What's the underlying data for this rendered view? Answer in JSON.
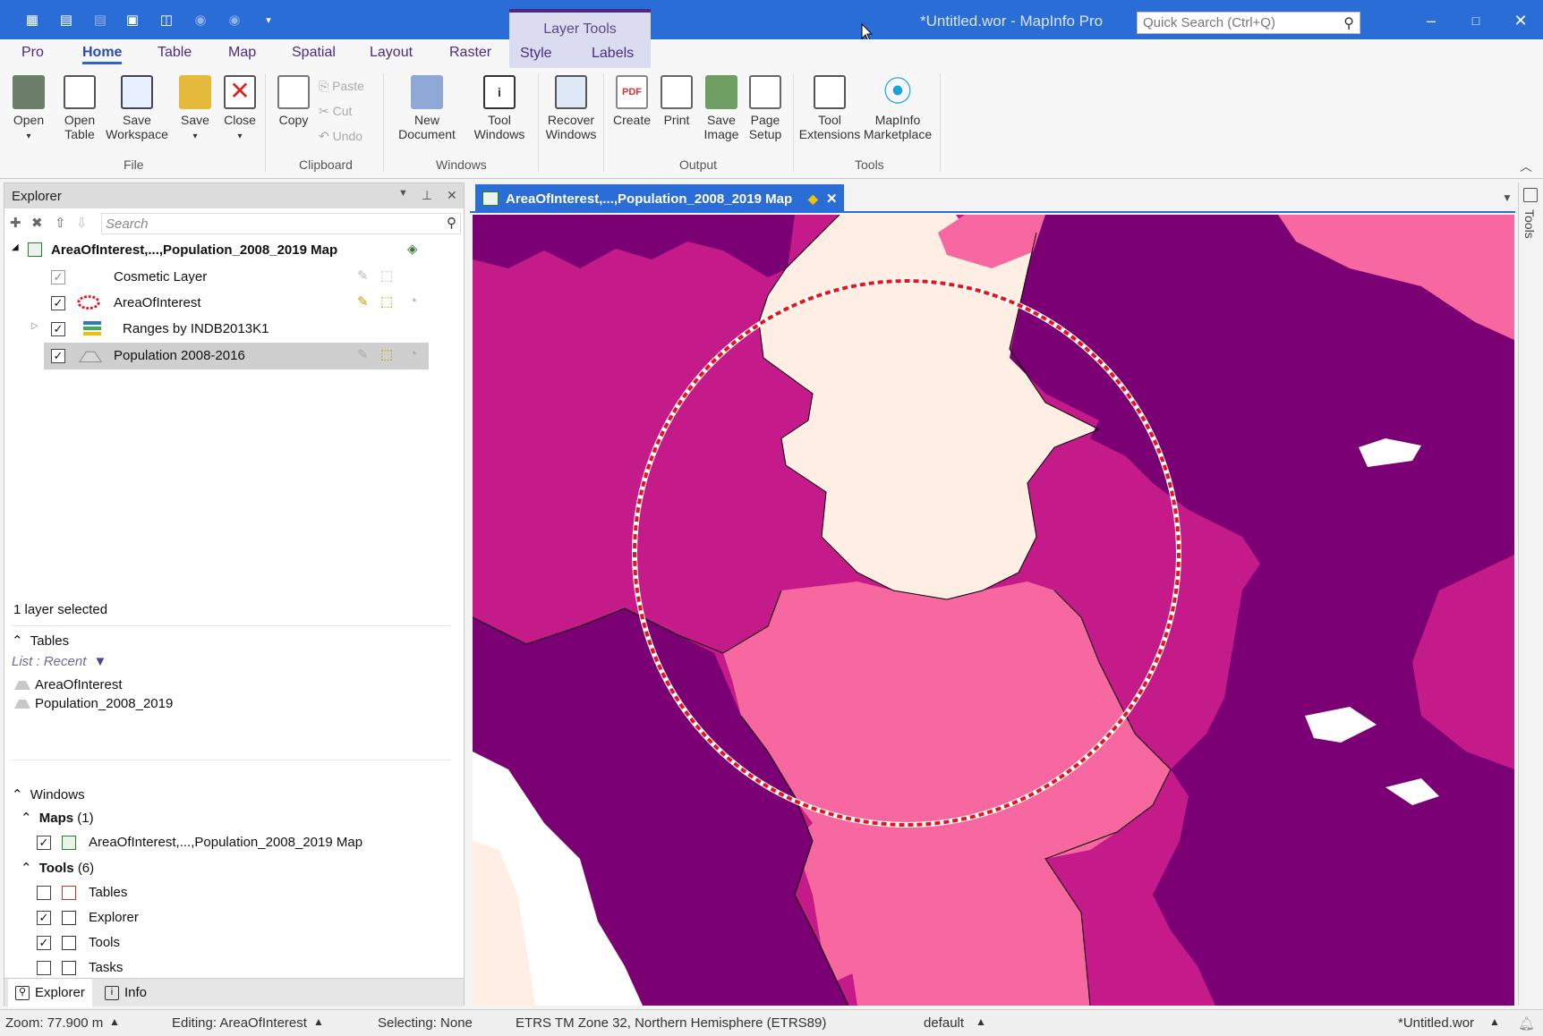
{
  "titlebar": {
    "title": "*Untitled.wor - MapInfo Pro",
    "context_tab_group": "Layer Tools",
    "quick_search_placeholder": "Quick Search (Ctrl+Q)",
    "qat_icons": [
      "table-icon",
      "new-browser-icon",
      "new-browser-disabled-icon",
      "new-mapper-icon",
      "new-layout-icon",
      "pin-icon",
      "pin-icon",
      "customize-chevron-icon"
    ]
  },
  "ribbon": {
    "tabs": [
      "Pro",
      "Home",
      "Table",
      "Map",
      "Spatial",
      "Layout",
      "Raster",
      "Style",
      "Labels"
    ],
    "active_tab": "Home",
    "file": {
      "group": "File",
      "open": "Open",
      "open_table": "Open\nTable",
      "save_workspace": "Save\nWorkspace",
      "save": "Save",
      "close": "Close"
    },
    "clipboard": {
      "group": "Clipboard",
      "copy": "Copy",
      "paste": "Paste",
      "cut": "Cut",
      "undo": "Undo"
    },
    "windows": {
      "group": "Windows",
      "new_document": "New\nDocument",
      "tool_windows": "Tool\nWindows",
      "recover_windows": "Recover\nWindows"
    },
    "output": {
      "group": "Output",
      "create": "Create",
      "print": "Print",
      "save_image": "Save\nImage",
      "page_setup": "Page\nSetup"
    },
    "tools": {
      "group": "Tools",
      "tool_extensions": "Tool\nExtensions",
      "marketplace": "MapInfo\nMarketplace"
    }
  },
  "explorer": {
    "title": "Explorer",
    "search_placeholder": "Search",
    "map_name": "AreaOfInterest,...,Population_2008_2019 Map",
    "layers": [
      {
        "name": "Cosmetic Layer",
        "checked": true
      },
      {
        "name": "AreaOfInterest",
        "checked": true
      },
      {
        "name": "Ranges by INDB2013K1",
        "checked": true
      },
      {
        "name": "Population 2008-2016",
        "checked": true,
        "selected": true
      }
    ],
    "selection_status": "1 layer selected",
    "tables_header": "Tables",
    "tables_list_mode": "List : Recent",
    "tables": [
      "AreaOfInterest",
      "Population_2008_2019"
    ],
    "windows_header": "Windows",
    "maps_header": "Maps",
    "maps_count": "(1)",
    "maps": [
      "AreaOfInterest,...,Population_2008_2019 Map"
    ],
    "tools_header": "Tools",
    "tools_count": "(6)",
    "tools": [
      {
        "name": "Tables",
        "checked": false
      },
      {
        "name": "Explorer",
        "checked": true
      },
      {
        "name": "Tools",
        "checked": true
      },
      {
        "name": "Tasks",
        "checked": false
      }
    ],
    "bottom_tabs": [
      "Explorer",
      "Info"
    ]
  },
  "map_window": {
    "tab_label": "AreaOfInterest,...,Population_2008_2019 Map",
    "colors": {
      "dark_purple": "#7a0073",
      "magenta": "#c51b8a",
      "pink": "#f768a1",
      "light": "#ffeee3",
      "circle": "#e8141c"
    }
  },
  "tools_strip": {
    "label": "Tools"
  },
  "statusbar": {
    "zoom": "Zoom: 77.900 m",
    "editing": "Editing: AreaOfInterest",
    "selecting": "Selecting: None",
    "projection": "ETRS TM Zone 32, Northern Hemisphere (ETRS89)",
    "style": "default",
    "workspace": "*Untitled.wor"
  }
}
